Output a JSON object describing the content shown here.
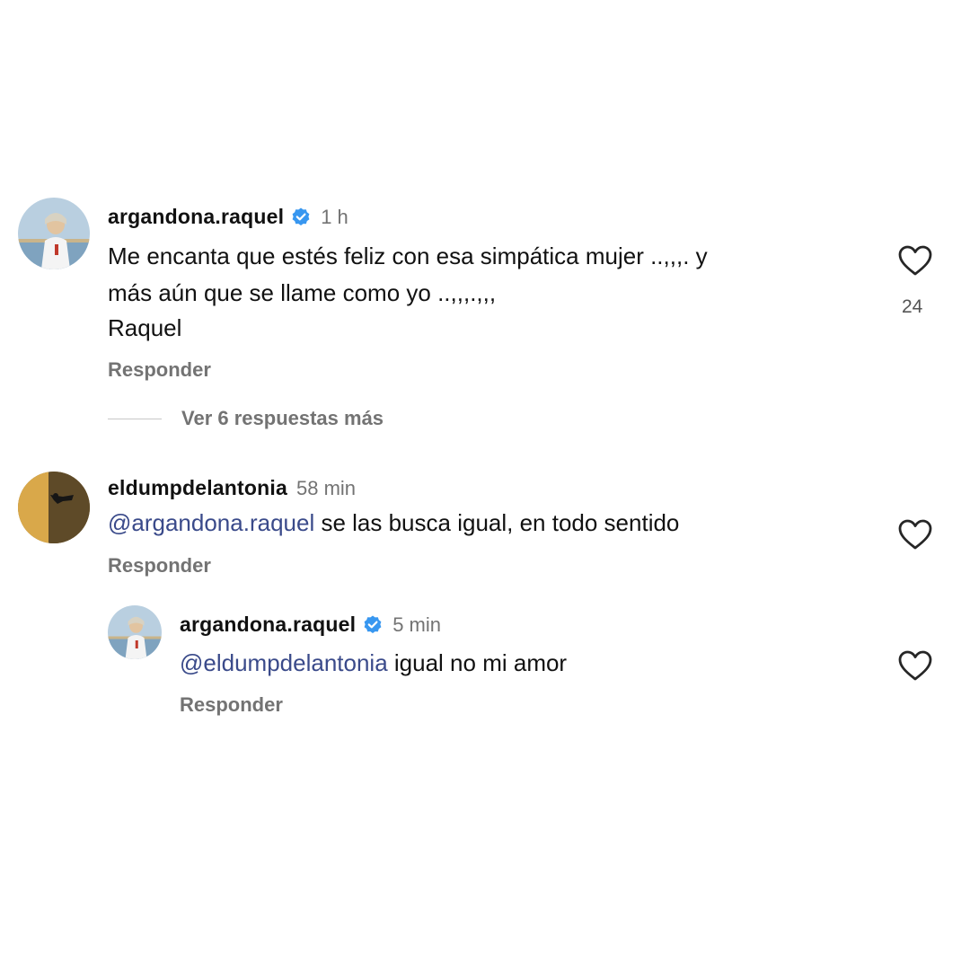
{
  "comments": [
    {
      "username": "argandona.raquel",
      "verified": true,
      "time": "1 h",
      "lines": [
        "Me encanta que estés feliz con esa simpática mujer ..,,,. y",
        "más aún que se llame como yo ..,,,.,,,"
      ],
      "signature": "Raquel",
      "reply_label": "Responder",
      "likes": "24",
      "view_replies": "Ver 6 respuestas más"
    },
    {
      "username": "eldumpdelantonia",
      "verified": false,
      "time": "58 min",
      "mention": "@argandona.raquel",
      "text": " se las busca igual, en todo sentido",
      "reply_label": "Responder"
    },
    {
      "username": "argandona.raquel",
      "verified": true,
      "time": "5 min",
      "mention": "@eldumpdelantonia",
      "text": " igual no mi amor",
      "reply_label": "Responder"
    }
  ],
  "icons": {
    "heart": "heart-outline-icon",
    "verified": "verified-badge-icon"
  },
  "colors": {
    "verified_blue": "#3897f0",
    "mention": "#3a4a8a",
    "secondary_text": "#737373"
  }
}
